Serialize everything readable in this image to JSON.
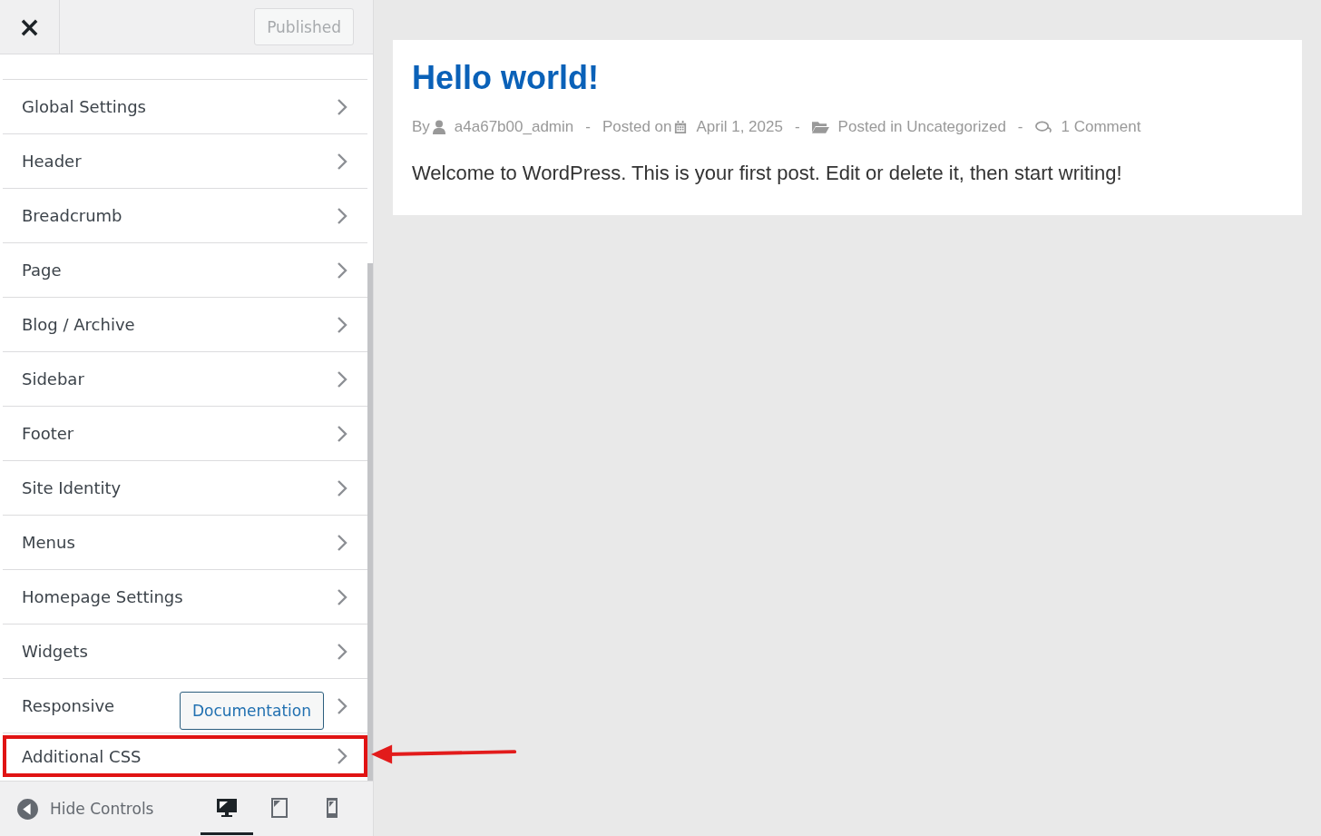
{
  "header": {
    "close": "×",
    "publish_button": {
      "label": "Published",
      "disabled": true
    }
  },
  "sections": [
    {
      "label": "Global Settings",
      "highlighted": false
    },
    {
      "label": "Header",
      "highlighted": false
    },
    {
      "label": "Breadcrumb",
      "highlighted": false
    },
    {
      "label": "Page",
      "highlighted": false
    },
    {
      "label": "Blog / Archive",
      "highlighted": false
    },
    {
      "label": "Sidebar",
      "highlighted": false
    },
    {
      "label": "Footer",
      "highlighted": false
    },
    {
      "label": "Site Identity",
      "highlighted": false
    },
    {
      "label": "Menus",
      "highlighted": false
    },
    {
      "label": "Homepage Settings",
      "highlighted": false
    },
    {
      "label": "Widgets",
      "highlighted": false
    },
    {
      "label": "Responsive",
      "highlighted": false,
      "button": "Documentation"
    },
    {
      "label": "Additional CSS",
      "highlighted": true
    }
  ],
  "footer": {
    "hide_controls": "Hide Controls",
    "devices": [
      {
        "kind": "desktop",
        "selected": true
      },
      {
        "kind": "tablet",
        "selected": false
      },
      {
        "kind": "mobile",
        "selected": false
      }
    ]
  },
  "post": {
    "title": "Hello world!",
    "meta": [
      {
        "kind": "author",
        "prefix": "By",
        "value": "a4a67b00_admin"
      },
      {
        "kind": "date",
        "prefix": "Posted on",
        "value": "April 1, 2025"
      },
      {
        "kind": "category",
        "value": "Posted in Uncategorized"
      },
      {
        "kind": "comments",
        "value": "1 Comment"
      }
    ],
    "separator": "-",
    "body": "Welcome to WordPress. This is your first post. Edit or delete it, then start writing!"
  }
}
